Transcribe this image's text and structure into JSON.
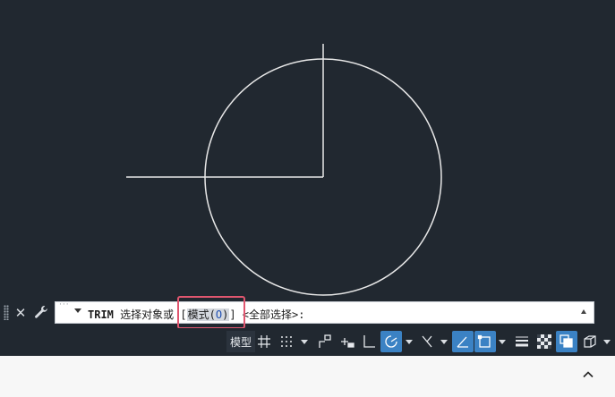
{
  "command_line": {
    "command": "TRIM",
    "prompt_before": " 选择对象或 ",
    "bracket_open": "[",
    "option_label": "模式",
    "option_key": "O",
    "bracket_close": "]",
    "default_option": " <全部选择>:"
  },
  "status_bar": {
    "model_label": "模型"
  },
  "colors": {
    "canvas": "#212830",
    "geometry": "#e8e8e8",
    "accent": "#3b82c4",
    "highlight": "#e0566f"
  }
}
